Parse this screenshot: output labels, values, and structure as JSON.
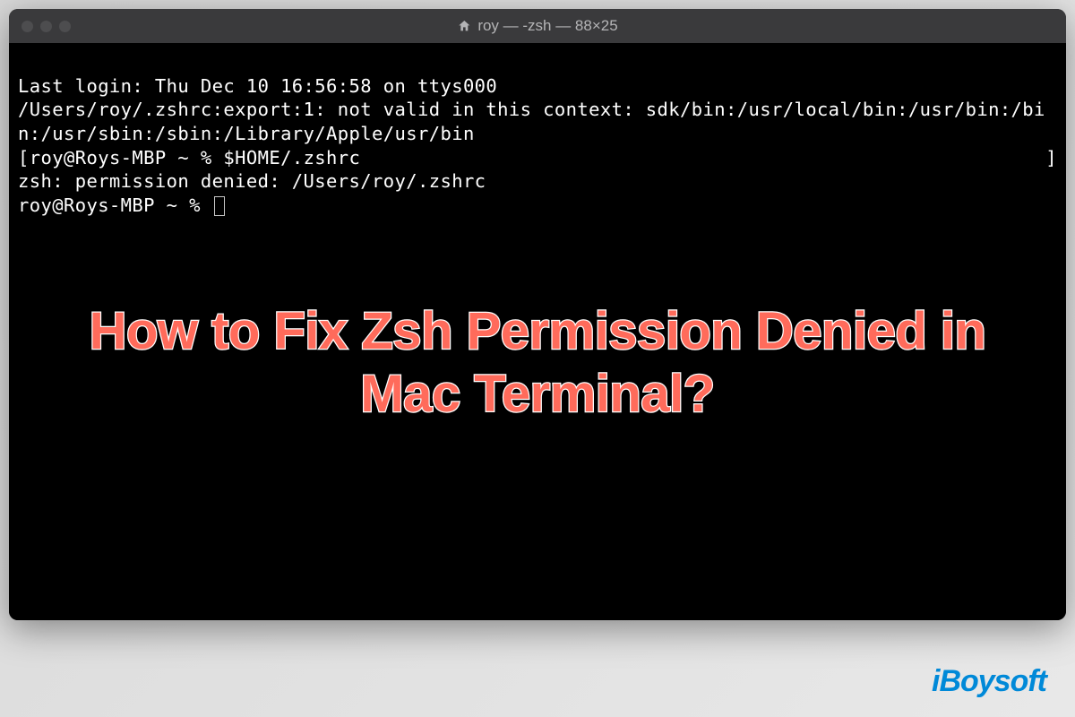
{
  "window": {
    "title": "roy — -zsh — 88×25"
  },
  "terminal": {
    "line1": "Last login: Thu Dec 10 16:56:58 on ttys000",
    "line2": "/Users/roy/.zshrc:export:1: not valid in this context: sdk/bin:/usr/local/bin:/usr/bin:/bin:/usr/sbin:/sbin:/Library/Apple/usr/bin",
    "line3_open": "[",
    "line3_prompt": "roy@Roys-MBP ~ % ",
    "line3_cmd": "$HOME/.zshrc",
    "line3_close": "]",
    "line4": "zsh: permission denied: /Users/roy/.zshrc",
    "line5_prompt": "roy@Roys-MBP ~ % "
  },
  "overlay": {
    "headline": "How to Fix Zsh Permission Denied in Mac Terminal?"
  },
  "brand": {
    "prefix": "i",
    "name": "Boysoft"
  }
}
